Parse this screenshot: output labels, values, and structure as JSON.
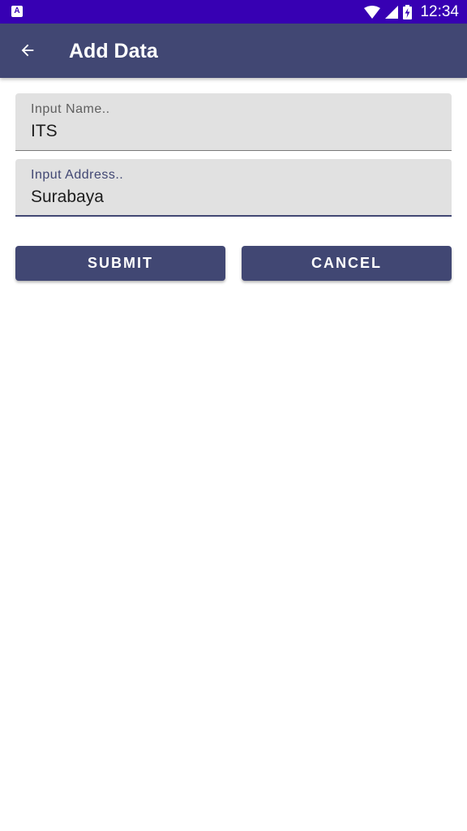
{
  "status_bar": {
    "left_icon_glyph": "A",
    "time": "12:34",
    "icons": [
      "wifi-icon",
      "signal-icon",
      "battery-charging-icon"
    ]
  },
  "app_bar": {
    "title": "Add Data",
    "back_icon": "arrow-back-icon"
  },
  "form": {
    "name": {
      "label": "Input Name..",
      "value": "ITS"
    },
    "address": {
      "label": "Input Address..",
      "value": "Surabaya"
    }
  },
  "buttons": {
    "submit_label": "SUBMIT",
    "cancel_label": "CANCEL"
  },
  "colors": {
    "status_bar": "#3700b3",
    "primary": "#414773",
    "field_background": "#e1e1e1"
  }
}
